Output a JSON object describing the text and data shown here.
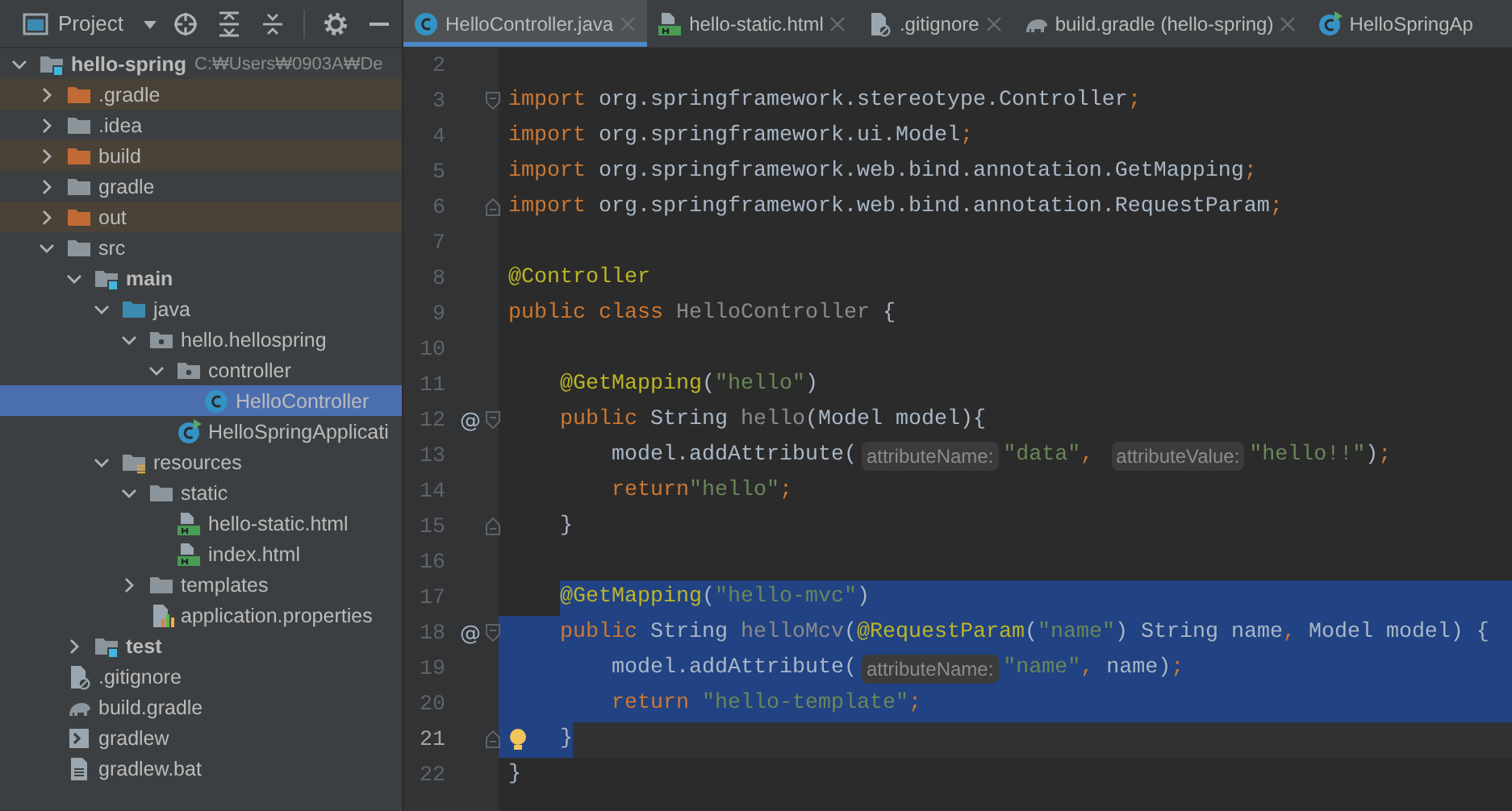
{
  "project": {
    "title": "Project",
    "tree": [
      {
        "label": "hello-spring",
        "path": "C:₩Users₩0903A₩De",
        "kind": "module",
        "bold": true,
        "expanded": true,
        "selected": false,
        "children": [
          {
            "label": ".gradle",
            "kind": "excluded",
            "excluded": true,
            "expanded": false,
            "selected": false
          },
          {
            "label": ".idea",
            "kind": "folder",
            "excluded": false,
            "expanded": false,
            "selected": false
          },
          {
            "label": "build",
            "kind": "excluded",
            "excluded": true,
            "expanded": false,
            "selected": false
          },
          {
            "label": "gradle",
            "kind": "folder",
            "excluded": false,
            "expanded": false,
            "selected": false
          },
          {
            "label": "out",
            "kind": "excluded",
            "excluded": true,
            "expanded": false,
            "selected": false
          },
          {
            "label": "src",
            "kind": "folder",
            "expanded": true,
            "selected": false,
            "children": [
              {
                "label": "main",
                "kind": "module",
                "bold": true,
                "expanded": true,
                "selected": false,
                "children": [
                  {
                    "label": "java",
                    "kind": "source",
                    "expanded": true,
                    "selected": false,
                    "children": [
                      {
                        "label": "hello.hellospring",
                        "kind": "package",
                        "expanded": true,
                        "selected": false,
                        "children": [
                          {
                            "label": "controller",
                            "kind": "package",
                            "expanded": true,
                            "selected": false,
                            "children": [
                              {
                                "label": "HelloController",
                                "kind": "class",
                                "selected": true
                              }
                            ]
                          },
                          {
                            "label": "HelloSpringApplicati",
                            "kind": "app",
                            "selected": false
                          }
                        ]
                      }
                    ]
                  },
                  {
                    "label": "resources",
                    "kind": "resources",
                    "expanded": true,
                    "selected": false,
                    "children": [
                      {
                        "label": "static",
                        "kind": "folder",
                        "expanded": true,
                        "selected": false,
                        "children": [
                          {
                            "label": "hello-static.html",
                            "kind": "html",
                            "selected": false
                          },
                          {
                            "label": "index.html",
                            "kind": "html",
                            "selected": false
                          }
                        ]
                      },
                      {
                        "label": "templates",
                        "kind": "folder",
                        "expanded": false,
                        "selected": false
                      },
                      {
                        "label": "application.properties",
                        "kind": "properties",
                        "selected": false
                      }
                    ]
                  }
                ]
              },
              {
                "label": "test",
                "kind": "module",
                "bold": true,
                "expanded": false,
                "selected": false
              }
            ]
          },
          {
            "label": ".gitignore",
            "kind": "gitignore",
            "selected": false
          },
          {
            "label": "build.gradle",
            "kind": "gradle",
            "selected": false
          },
          {
            "label": "gradlew",
            "kind": "script",
            "selected": false
          },
          {
            "label": "gradlew.bat",
            "kind": "file",
            "selected": false
          }
        ]
      }
    ]
  },
  "tabs": [
    {
      "label": "HelloController.java",
      "kind": "class",
      "selected": true
    },
    {
      "label": "hello-static.html",
      "kind": "html",
      "selected": false
    },
    {
      "label": ".gitignore",
      "kind": "gitignore",
      "selected": false
    },
    {
      "label": "build.gradle (hello-spring)",
      "kind": "gradle",
      "selected": false
    },
    {
      "label": "HelloSpringAp",
      "kind": "app",
      "selected": false
    }
  ],
  "editor": {
    "lines": [
      {
        "number": "2",
        "selected": false
      },
      {
        "number": "3",
        "fold_start": true,
        "selected": false,
        "tokens": [
          {
            "kind": "kw",
            "text": "import "
          },
          {
            "kind": "plain",
            "text": "org.springframework.stereotype.Controller"
          },
          {
            "kind": "kw",
            "text": ";"
          }
        ]
      },
      {
        "number": "4",
        "selected": false,
        "tokens": [
          {
            "kind": "kw",
            "text": "import "
          },
          {
            "kind": "plain",
            "text": "org.springframework.ui.Model"
          },
          {
            "kind": "kw",
            "text": ";"
          }
        ]
      },
      {
        "number": "5",
        "selected": false,
        "tokens": [
          {
            "kind": "kw",
            "text": "import "
          },
          {
            "kind": "plain",
            "text": "org.springframework.web.bind.annotation.GetMapping"
          },
          {
            "kind": "kw",
            "text": ";"
          }
        ]
      },
      {
        "number": "6",
        "fold_end": true,
        "selected": false,
        "tokens": [
          {
            "kind": "kw",
            "text": "import "
          },
          {
            "kind": "plain",
            "text": "org.springframework.web.bind.annotation.RequestParam"
          },
          {
            "kind": "kw",
            "text": ";"
          }
        ]
      },
      {
        "number": "7",
        "selected": false
      },
      {
        "number": "8",
        "selected": false,
        "tokens": [
          {
            "kind": "ann",
            "text": "@Controller"
          }
        ]
      },
      {
        "number": "9",
        "selected": false,
        "tokens": [
          {
            "kind": "kw",
            "text": "public class "
          },
          {
            "kind": "dim",
            "text": "HelloController"
          },
          {
            "kind": "plain",
            "text": " {"
          }
        ],
        "children": [
          {
            "number": "10",
            "selected": false
          },
          {
            "number": "11",
            "selected": false,
            "tokens": [
              {
                "kind": "ann",
                "text": "@GetMapping"
              },
              {
                "kind": "plain",
                "text": "("
              },
              {
                "kind": "str",
                "text": "\"hello\""
              },
              {
                "kind": "plain",
                "text": ")"
              }
            ]
          },
          {
            "number": "12",
            "mark": "@",
            "fold_start": true,
            "selected": false,
            "tokens": [
              {
                "kind": "kw",
                "text": "public "
              },
              {
                "kind": "plain",
                "text": "String "
              },
              {
                "kind": "dim",
                "text": "hello"
              },
              {
                "kind": "plain",
                "text": "(Model model){"
              }
            ],
            "children": [
              {
                "number": "13",
                "selected": false,
                "tokens": [
                  {
                    "kind": "plain",
                    "text": "model.addAttribute("
                  },
                  {
                    "kind": "hint",
                    "text": "attributeName:"
                  },
                  {
                    "kind": "str",
                    "text": "\"data\""
                  },
                  {
                    "kind": "kw",
                    "text": ", "
                  },
                  {
                    "kind": "hint",
                    "text": "attributeValue:"
                  },
                  {
                    "kind": "str",
                    "text": "\"hello!!\""
                  },
                  {
                    "kind": "plain",
                    "text": ")"
                  },
                  {
                    "kind": "kw",
                    "text": ";"
                  }
                ]
              },
              {
                "number": "14",
                "selected": false,
                "tokens": [
                  {
                    "kind": "kw",
                    "text": "return"
                  },
                  {
                    "kind": "str",
                    "text": "\"hello\""
                  },
                  {
                    "kind": "kw",
                    "text": ";"
                  }
                ]
              }
            ]
          },
          {
            "number": "15",
            "fold_end": true,
            "selected": false,
            "tokens": [
              {
                "kind": "plain",
                "text": "}"
              }
            ]
          },
          {
            "number": "16",
            "selected": false
          },
          {
            "number": "17",
            "selected": true,
            "tokens": [
              {
                "kind": "ann",
                "text": "@GetMapping"
              },
              {
                "kind": "plain",
                "text": "("
              },
              {
                "kind": "str",
                "text": "\"hello-mvc\""
              },
              {
                "kind": "plain",
                "text": ")"
              }
            ]
          },
          {
            "number": "18",
            "mark": "@",
            "fold_start": true,
            "selected": true,
            "tokens": [
              {
                "kind": "kw",
                "text": "public "
              },
              {
                "kind": "plain",
                "text": "String "
              },
              {
                "kind": "dim",
                "text": "helloMcv"
              },
              {
                "kind": "plain",
                "text": "("
              },
              {
                "kind": "ann",
                "text": "@RequestParam"
              },
              {
                "kind": "plain",
                "text": "("
              },
              {
                "kind": "str",
                "text": "\"name\""
              },
              {
                "kind": "plain",
                "text": ") String name"
              },
              {
                "kind": "kw",
                "text": ", "
              },
              {
                "kind": "plain",
                "text": "Model model) {"
              }
            ],
            "children": [
              {
                "number": "19",
                "selected": true,
                "tokens": [
                  {
                    "kind": "plain",
                    "text": "model.addAttribute("
                  },
                  {
                    "kind": "hint",
                    "text": "attributeName:"
                  },
                  {
                    "kind": "str",
                    "text": "\"name\""
                  },
                  {
                    "kind": "kw",
                    "text": ", "
                  },
                  {
                    "kind": "plain",
                    "text": "name)"
                  },
                  {
                    "kind": "kw",
                    "text": ";"
                  }
                ]
              },
              {
                "number": "20",
                "selected": true,
                "tokens": [
                  {
                    "kind": "kw",
                    "text": "return "
                  },
                  {
                    "kind": "str",
                    "text": "\"hello-template\""
                  },
                  {
                    "kind": "kw",
                    "text": ";"
                  }
                ]
              }
            ]
          },
          {
            "number": "21",
            "fold_end": true,
            "current": true,
            "intention": true,
            "selected": true,
            "tokens": [
              {
                "kind": "plain",
                "text": "}"
              }
            ]
          }
        ]
      },
      {
        "number": "22",
        "selected": false,
        "tokens": [
          {
            "kind": "plain",
            "text": "}"
          }
        ]
      }
    ]
  }
}
